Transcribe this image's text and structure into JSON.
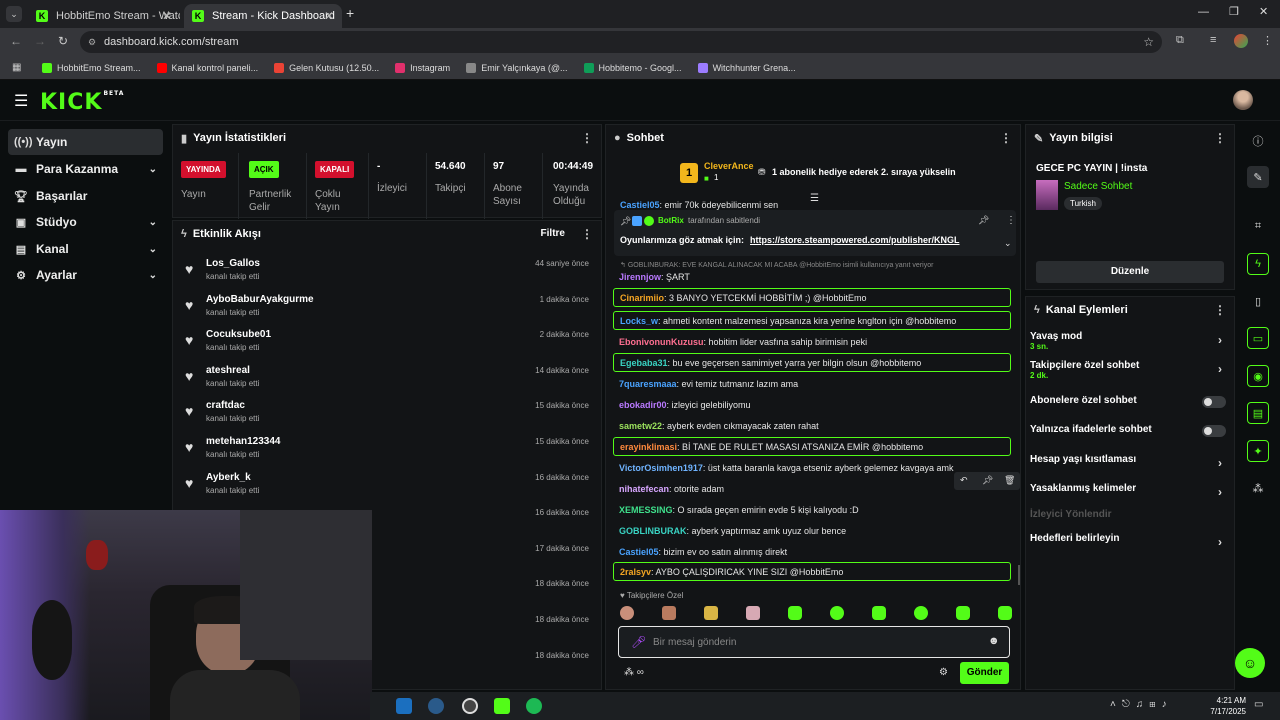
{
  "browser": {
    "tabs": [
      {
        "title": "HobbitEmo Stream - Watch Live"
      },
      {
        "title": "Stream - Kick Dashboard"
      }
    ],
    "url": "dashboard.kick.com/stream",
    "bookmarks": [
      {
        "label": "HobbitEmo Stream...",
        "color": "#53fc18"
      },
      {
        "label": "Kanal kontrol paneli...",
        "color": "#ff0000"
      },
      {
        "label": "Gelen Kutusu (12.50...",
        "color": "#ea4335"
      },
      {
        "label": "Instagram",
        "color": "#e1306c"
      },
      {
        "label": "Emir Yalçınkaya (@...",
        "color": "#888888"
      },
      {
        "label": "Hobbitemo - Googl...",
        "color": "#0f9d58"
      },
      {
        "label": "Witchhunter Grena...",
        "color": "#9c7cff"
      }
    ]
  },
  "brand": {
    "logo": "KICK",
    "beta": "BETA",
    "accent": "#53fc18"
  },
  "nav": {
    "items": [
      {
        "label": "Yayın",
        "icon": "broadcast-icon"
      },
      {
        "label": "Para Kazanma",
        "icon": "money-icon"
      },
      {
        "label": "Başarılar",
        "icon": "trophy-icon"
      },
      {
        "label": "Stüdyo",
        "icon": "studio-icon"
      },
      {
        "label": "Kanal",
        "icon": "channel-icon"
      },
      {
        "label": "Ayarlar",
        "icon": "gear-icon"
      }
    ]
  },
  "stats": {
    "title": "Yayın İstatistikleri",
    "items": [
      {
        "badge": "YAYINDA",
        "label": "Yayın"
      },
      {
        "badge": "AÇIK",
        "label": "Partnerlik Gelir"
      },
      {
        "badge": "KAPALI",
        "label": "Çoklu Yayın"
      },
      {
        "value": "-",
        "label": "İzleyici"
      },
      {
        "value": "54.640",
        "label": "Takipçi"
      },
      {
        "value": "97",
        "label": "Abone Sayısı"
      },
      {
        "value": "00:44:49",
        "label": "Yayında Olduğu Süre"
      }
    ]
  },
  "activity": {
    "title": "Etkinlik Akışı",
    "filter": "Filtre",
    "items": [
      {
        "user": "Los_Gallos",
        "action": "kanalı takip etti",
        "time": "44 saniye önce"
      },
      {
        "user": "AyboBaburAyakgurme",
        "action": "kanalı takip etti",
        "time": "1 dakika önce"
      },
      {
        "user": "Cocuksube01",
        "action": "kanalı takip etti",
        "time": "2 dakika önce"
      },
      {
        "user": "ateshreal",
        "action": "kanalı takip etti",
        "time": "14 dakika önce"
      },
      {
        "user": "craftdac",
        "action": "kanalı takip etti",
        "time": "15 dakika önce"
      },
      {
        "user": "metehan123344",
        "action": "kanalı takip etti",
        "time": "15 dakika önce"
      },
      {
        "user": "Ayberk_k",
        "action": "kanalı takip etti",
        "time": "16 dakika önce"
      },
      {
        "user": "",
        "action": "",
        "time": "16 dakika önce"
      },
      {
        "user": "",
        "action": "",
        "time": "17 dakika önce"
      },
      {
        "user": "",
        "action": "",
        "time": "18 dakika önce"
      },
      {
        "user": "",
        "action": "",
        "time": "18 dakika önce"
      },
      {
        "user": "",
        "action": "",
        "time": "18 dakika önce"
      }
    ]
  },
  "chat": {
    "title": "Sohbet",
    "gift_rank": "1",
    "gift_user": "CleverAnce",
    "gift_count": "1",
    "gift_text": "1 abonelik hediye ederek 2. sıraya yükselin",
    "partial_top": {
      "user": "Castiel05",
      "text": ": emir 70k ödeyebilicenmi sen"
    },
    "pinned_by": "BotRix",
    "pinned_label": "tarafından sabitlendi",
    "pinned_text": "Oyunlarımıza göz atmak için:",
    "pinned_link": "https://store.steampowered.com/publisher/KNGL",
    "reply_context": "GOBLINBURAK: EVE KANGAL ALINACAK MI ACABA @HobbitEmo isimli kullanıcıya yanıt veriyor",
    "messages": [
      {
        "user": "Jirennjow",
        "text": ": ŞART",
        "color": "#b979ff",
        "hl": false
      },
      {
        "user": "Cinarimiio",
        "text": ": 3 BANYO YETCEKMİ HOBBİTİM ;) @HobbitEmo",
        "color": "#f5a623",
        "hl": true
      },
      {
        "user": "Locks_w",
        "text": ": ahmeti kontent malzemesi yapsanıza kira yerine knglton için @hobbitemo",
        "color": "#4aa3ff",
        "hl": true
      },
      {
        "user": "EbonivonunKuzusu",
        "text": ": hobitim lider vasfına sahip birimisin peki",
        "color": "#ff6f91",
        "hl": false
      },
      {
        "user": "Egebaba31",
        "text": ": bu eve geçersen samimiyet yarra yer bilgin olsun @hobbitemo",
        "color": "#39d3c3",
        "hl": true
      },
      {
        "user": "7quaresmaaa",
        "text": ": evi temiz tutmanız lazım ama",
        "color": "#4aa3ff",
        "hl": false
      },
      {
        "user": "ebokadir00",
        "text": ": izleyici gelebiliyomu",
        "color": "#b979ff",
        "hl": false
      },
      {
        "user": "sametw22",
        "text": ": ayberk evden cıkmayacak zaten rahat",
        "color": "#9be15d",
        "hl": false
      },
      {
        "user": "erayinklimasi",
        "text": ": Bİ TANE DE RULET MASASI ATSANIZA EMİR @hobbitemo",
        "color": "#ff8a3d",
        "hl": true
      },
      {
        "user": "VictorOsimhen1917",
        "text": ": üst katta baranla kavga etseniz ayberk gelemez kavgaya amk",
        "color": "#6fb3ff",
        "hl": false
      },
      {
        "user": "nihatefecan",
        "text": ": otorite adam",
        "color": "#d7a6ff",
        "hl": false
      },
      {
        "user": "XEMESSING",
        "text": ": O sırada geçen emirin evde 5 kişi kalıyodu :D",
        "color": "#3fe08c",
        "hl": false
      },
      {
        "user": "GOBLINBURAK",
        "text": ": ayberk yaptırmaz amk uyuz olur bence",
        "color": "#39d3c3",
        "hl": false
      },
      {
        "user": "Castiel05",
        "text": ": bizim ev oo satın alınmış direkt",
        "color": "#4aa3ff",
        "hl": false
      },
      {
        "user": "2ralsyv",
        "text": ": AYBO ÇALIŞDIRICAK YINE SIZI @HobbitEmo",
        "color": "#f5a623",
        "hl": true
      }
    ],
    "followers_only": "Takipçilere Özel",
    "input_placeholder": "Bir mesaj gönderin",
    "send": "Gönder"
  },
  "stream_info": {
    "title": "Yayın bilgisi",
    "stream_title": "GECE PC YAYIN | !insta",
    "category": "Sadece Sohbet",
    "language": "Turkish",
    "edit": "Düzenle"
  },
  "channel_actions": {
    "title": "Kanal Eylemleri",
    "items": [
      {
        "label": "Yavaş mod",
        "sub": "3 sn.",
        "control": "arrow"
      },
      {
        "label": "Takipçilere özel sohbet",
        "sub": "2 dk.",
        "control": "arrow"
      },
      {
        "label": "Abonelere özel sohbet",
        "sub": "",
        "control": "toggle"
      },
      {
        "label": "Yalnızca ifadelerle sohbet",
        "sub": "",
        "control": "toggle"
      },
      {
        "label": "Hesap yaşı kısıtlaması",
        "sub": "",
        "control": "arrow"
      },
      {
        "label": "Yasaklanmış kelimeler",
        "sub": "",
        "control": "arrow"
      },
      {
        "label": "İzleyici Yönlendir",
        "sub": "",
        "control": "none"
      },
      {
        "label": "Hedefleri belirleyin",
        "sub": "",
        "control": "arrow"
      }
    ]
  },
  "taskbar": {
    "time": "4:21 AM",
    "date": "7/17/2025"
  }
}
